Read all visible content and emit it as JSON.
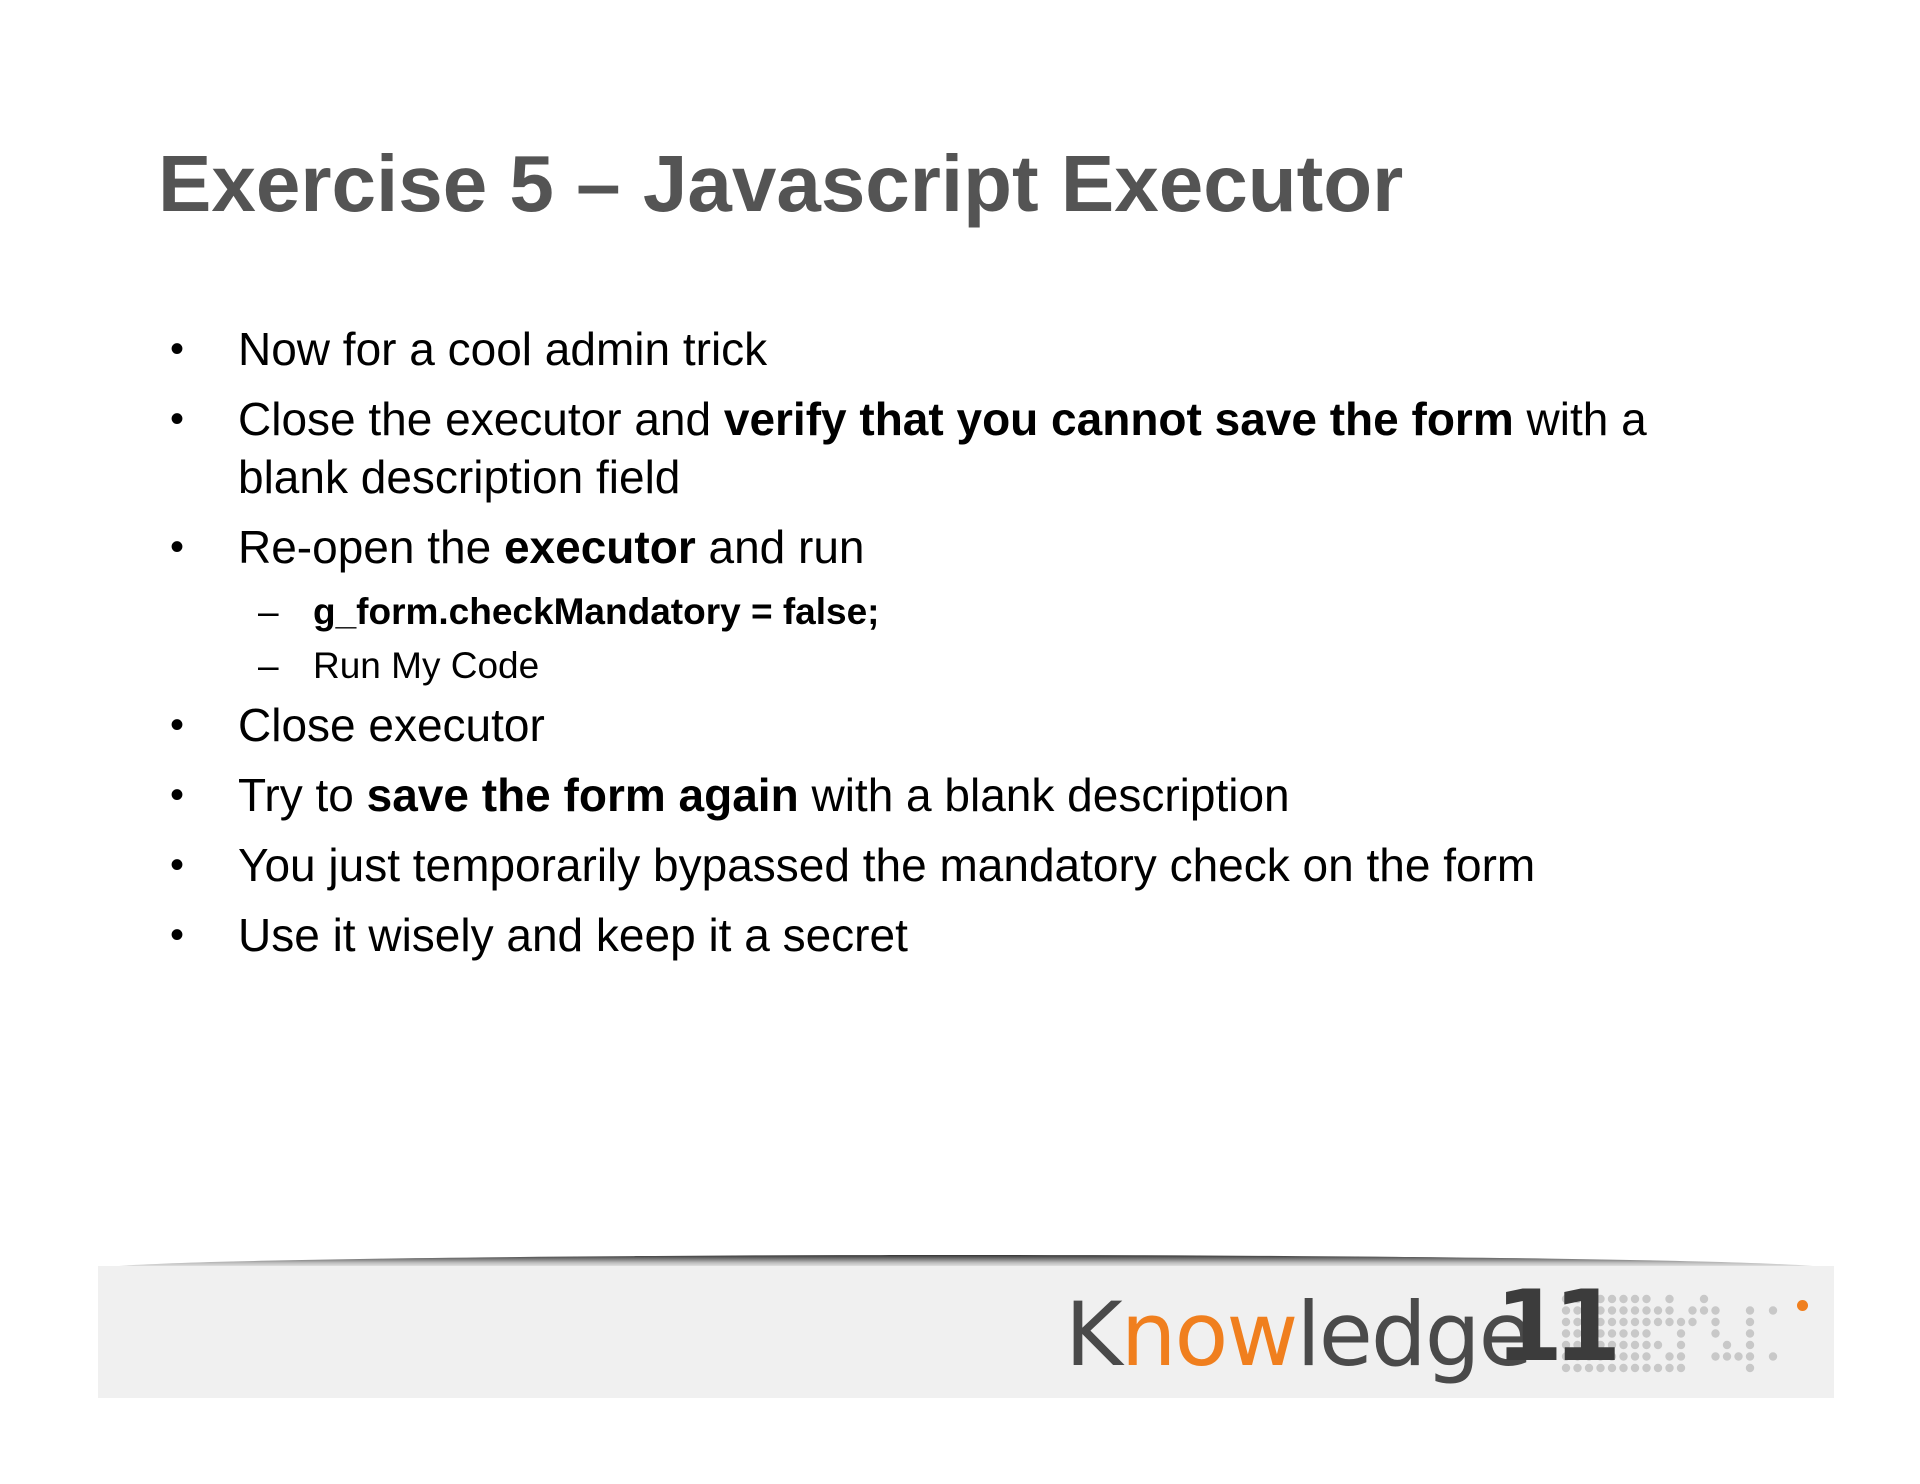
{
  "slide": {
    "title": "Exercise 5 – Javascript Executor",
    "bullet_glyph": "•",
    "dash_glyph": "–",
    "bullets": [
      {
        "segments": [
          {
            "text": "Now for a cool admin trick",
            "bold": false
          }
        ]
      },
      {
        "segments": [
          {
            "text": "Close the executor and ",
            "bold": false
          },
          {
            "text": "verify that you cannot save the form",
            "bold": true
          },
          {
            "text": " with a blank description field",
            "bold": false
          }
        ]
      },
      {
        "segments": [
          {
            "text": "Re-open the ",
            "bold": false
          },
          {
            "text": "executor",
            "bold": true
          },
          {
            "text": " and run",
            "bold": false
          }
        ],
        "sub_items": [
          {
            "text": "g_form.checkMandatory = false;",
            "bold": true
          },
          {
            "text": "Run My Code",
            "bold": false
          }
        ]
      },
      {
        "segments": [
          {
            "text": "Close executor",
            "bold": false
          }
        ]
      },
      {
        "segments": [
          {
            "text": "Try to ",
            "bold": false
          },
          {
            "text": "save the form again",
            "bold": true
          },
          {
            "text": " with a blank description",
            "bold": false
          }
        ]
      },
      {
        "segments": [
          {
            "text": "You just temporarily bypassed the mandatory check on the form",
            "bold": false
          }
        ]
      },
      {
        "segments": [
          {
            "text": "Use it wisely and keep it a secret",
            "bold": false
          }
        ]
      }
    ]
  },
  "footer": {
    "logo": {
      "word_start": "K",
      "word_accent": "now",
      "word_end": "ledge",
      "number": "11",
      "colors": {
        "text": "#4a4a4a",
        "accent": "#f07f1e",
        "dots": "#c8c8c8"
      }
    }
  }
}
